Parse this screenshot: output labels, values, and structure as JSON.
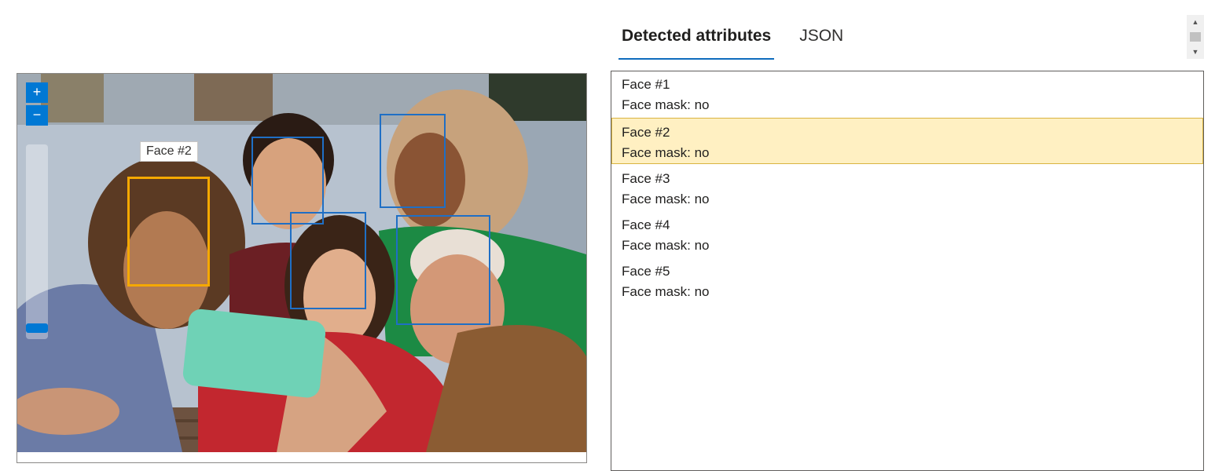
{
  "tabs": [
    {
      "label": "Detected attributes",
      "active": true
    },
    {
      "label": "JSON",
      "active": false
    }
  ],
  "viewer": {
    "zoom_in_label": "+",
    "zoom_out_label": "−",
    "tooltip": "Face #2",
    "active_face": 2
  },
  "faces": [
    {
      "name": "Face #1",
      "mask": "Face mask: no"
    },
    {
      "name": "Face #2",
      "mask": "Face mask: no"
    },
    {
      "name": "Face #3",
      "mask": "Face mask: no"
    },
    {
      "name": "Face #4",
      "mask": "Face mask: no"
    },
    {
      "name": "Face #5",
      "mask": "Face mask: no"
    }
  ],
  "colors": {
    "accent": "#0078d4",
    "face_box": "#1f6fc5",
    "face_box_active": "#f5a800",
    "selected_row": "#fff0c2"
  }
}
